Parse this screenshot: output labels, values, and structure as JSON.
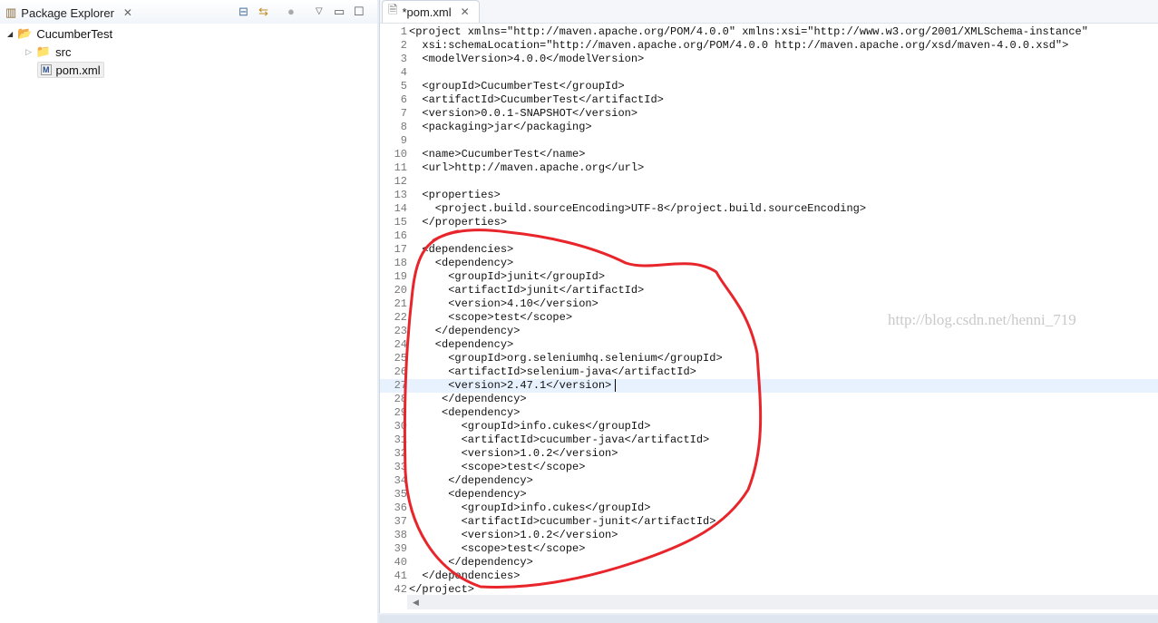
{
  "explorer": {
    "title": "Package Explorer",
    "project": "CucumberTest",
    "src": "src",
    "pom": "pom.xml"
  },
  "editor": {
    "tab": "*pom.xml",
    "watermark": "http://blog.csdn.net/henni_719",
    "current_line": 27,
    "lines": [
      "<project xmlns=\"http://maven.apache.org/POM/4.0.0\" xmlns:xsi=\"http://www.w3.org/2001/XMLSchema-instance\"",
      "  xsi:schemaLocation=\"http://maven.apache.org/POM/4.0.0 http://maven.apache.org/xsd/maven-4.0.0.xsd\">",
      "  <modelVersion>4.0.0</modelVersion>",
      "",
      "  <groupId>CucumberTest</groupId>",
      "  <artifactId>CucumberTest</artifactId>",
      "  <version>0.0.1-SNAPSHOT</version>",
      "  <packaging>jar</packaging>",
      "",
      "  <name>CucumberTest</name>",
      "  <url>http://maven.apache.org</url>",
      "",
      "  <properties>",
      "    <project.build.sourceEncoding>UTF-8</project.build.sourceEncoding>",
      "  </properties>",
      "",
      "  <dependencies>",
      "    <dependency>",
      "      <groupId>junit</groupId>",
      "      <artifactId>junit</artifactId>",
      "      <version>4.10</version>",
      "      <scope>test</scope>",
      "    </dependency>",
      "    <dependency>",
      "      <groupId>org.seleniumhq.selenium</groupId>",
      "      <artifactId>selenium-java</artifactId>",
      "      <version>2.47.1</version>",
      "     </dependency>",
      "     <dependency>",
      "        <groupId>info.cukes</groupId>",
      "        <artifactId>cucumber-java</artifactId>",
      "        <version>1.0.2</version>",
      "        <scope>test</scope>",
      "      </dependency>",
      "      <dependency>",
      "        <groupId>info.cukes</groupId>",
      "        <artifactId>cucumber-junit</artifactId>",
      "        <version>1.0.2</version>",
      "        <scope>test</scope>",
      "      </dependency>",
      "  </dependencies>",
      "</project>"
    ]
  },
  "colors": {
    "annotation": "#e8252b",
    "current_line": "#e8f2fe"
  }
}
